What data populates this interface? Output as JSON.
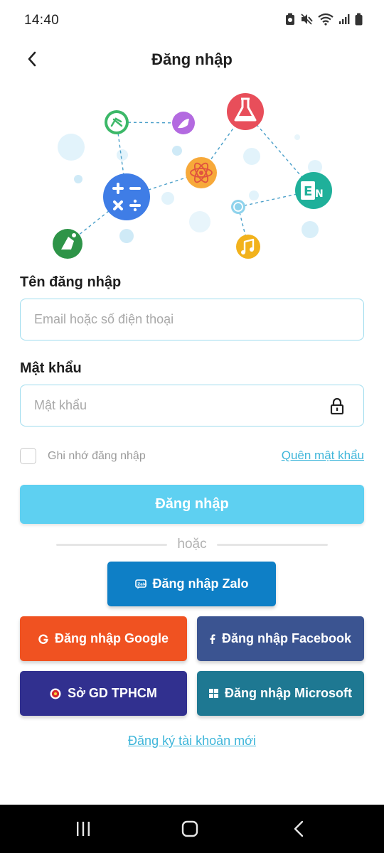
{
  "status_bar": {
    "time": "14:40"
  },
  "header": {
    "title": "Đăng nhập"
  },
  "illustration": {
    "icons": [
      "teacher-icon",
      "paint-icon",
      "chemistry-flask-icon",
      "math-operators-icon",
      "atom-icon",
      "english-language-icon",
      "globe-icon",
      "music-icon",
      "history-icon"
    ]
  },
  "form": {
    "username_label": "Tên đăng nhập",
    "username_placeholder": "Email hoặc số điện thoại",
    "password_label": "Mật khẩu",
    "password_placeholder": "Mật khẩu",
    "remember_label": "Ghi nhớ đăng nhập",
    "forgot_label": "Quên mật khẩu",
    "login_button": "Đăng nhập",
    "or_text": "hoặc"
  },
  "social": {
    "zalo": "Đăng nhập Zalo",
    "google": "Đăng nhập Google",
    "facebook": "Đăng nhập Facebook",
    "sogd": "Sở GD TPHCM",
    "microsoft": "Đăng nhập Microsoft"
  },
  "register_label": "Đăng ký tài khoản mới",
  "colors": {
    "accent": "#5ed0f1",
    "link": "#3fb6da",
    "zalo": "#0e7fc6",
    "google": "#f05221",
    "facebook": "#3b5491",
    "sogd": "#31308f",
    "microsoft": "#1e7892"
  }
}
